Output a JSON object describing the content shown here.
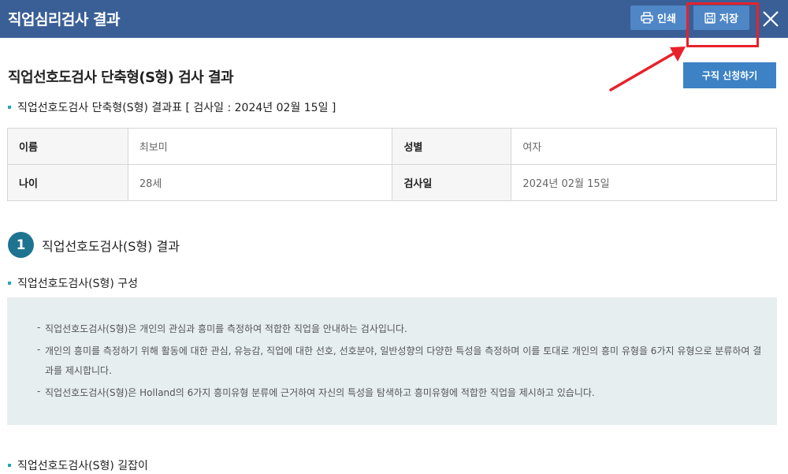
{
  "window": {
    "title": "직업심리검사 결과",
    "print_label": "인쇄",
    "save_label": "저장",
    "close_icon": "close-icon",
    "print_icon": "printer-icon",
    "save_icon": "floppy-disk-icon"
  },
  "annotation": {
    "highlight_color": "#e8212a"
  },
  "page": {
    "title": "직업선호도검사 단축형(S형) 검사 결과",
    "apply_button": "구직 신청하기",
    "result_table_heading": "직업선호도검사 단축형(S형) 결과표 [ 검사일 : 2024년 02월 15일 ]"
  },
  "info_table": {
    "rows": [
      {
        "label1": "이름",
        "value1": "최보미",
        "label2": "성별",
        "value2": "여자"
      },
      {
        "label1": "나이",
        "value1": "28세",
        "label2": "검사일",
        "value2": "2024년 02월 15일"
      }
    ]
  },
  "section1": {
    "number": "1",
    "title": "직업선호도검사(S형) 결과",
    "composition_heading": "직업선호도검사(S형) 구성",
    "items": [
      "직업선호도검사(S형)은 개인의 관심과 흥미를 측정하여 적합한 직업을 안내하는 검사입니다.",
      "개인의 흥미를 측정하기 위해 활동에 대한 관심, 유능감, 직업에 대한 선호, 선호분야, 일반성향의 다양한 특성을 측정하며 이를 토대로 개인의 흥미 유형을 6가지 유형으로 분류하여 결과를 제시합니다.",
      "직업선호도검사(S형)은 Holland의 6가지 흥미유형 분류에 근거하여 자신의 특성을 탐색하고 흥미유형에 적합한 직업을 제시하고 있습니다."
    ],
    "guide_heading": "직업선호도검사(S형) 길잡이"
  },
  "colors": {
    "titlebar": "#3a5f96",
    "button": "#4f86c6",
    "accent": "#27a5b8",
    "section_badge": "#1e7390",
    "desc_bg": "#e6eef0"
  }
}
